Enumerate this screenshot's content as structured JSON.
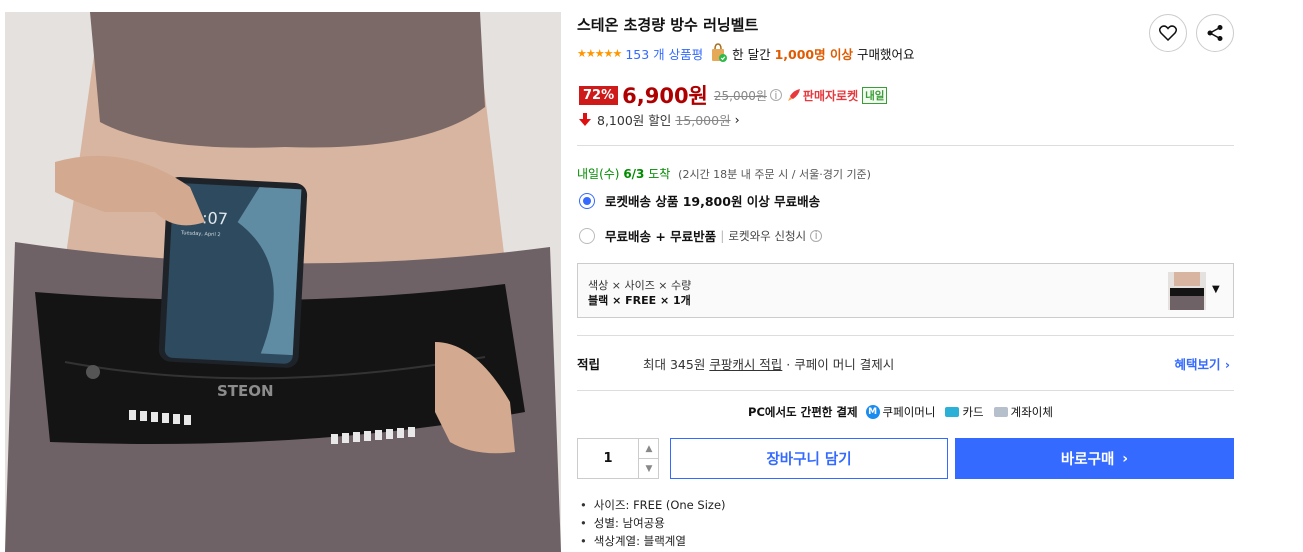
{
  "product": {
    "title": "스테온 초경량 방수 러닝벨트",
    "image_alt": "STEON",
    "rating_stars": "★★★★★",
    "review_count": "153 개 상품평",
    "buyers_prefix": "한 달간",
    "buyers_count": "1,000명 이상",
    "buyers_suffix": "구매했어요"
  },
  "price": {
    "discount": "72%",
    "sale": "6,900원",
    "original": "25,000원",
    "info_icon": "i",
    "rocket_label": "판매자로켓",
    "badge": "내일",
    "coupon_amount": "8,100원",
    "coupon_label": "할인",
    "coupon_original": "15,000원",
    "coupon_arrow": "›"
  },
  "delivery": {
    "day": "내일(수)",
    "date": "6/3",
    "arrive": "도착",
    "detail": "(2시간 18분 내 주문 시 / 서울·경기 기준)"
  },
  "shipping_options": [
    {
      "label": "로켓배송 상품 19,800원 이상 무료배송",
      "sub": "",
      "checked": true
    },
    {
      "label": "무료배송 + 무료반품",
      "sub": "로켓와우 신청시",
      "checked": false
    }
  ],
  "option": {
    "header": "색상 × 사이즈 × 수량",
    "value": "블랙 × FREE × 1개",
    "caret": "▼"
  },
  "points": {
    "label": "적립",
    "text_prefix": "최대 345원",
    "text_link": "쿠팡캐시 적립",
    "text_suffix": "· 쿠페이 머니 결제시",
    "benefit_link": "혜택보기 ›"
  },
  "payment": {
    "title": "PC에서도 간편한 결제",
    "methods": [
      {
        "name": "쿠페이머니",
        "icon": "m-icon"
      },
      {
        "name": "카드",
        "icon": "card-icon"
      },
      {
        "name": "계좌이체",
        "icon": "bank-icon"
      }
    ],
    "m_glyph": "M"
  },
  "purchase": {
    "quantity": "1",
    "up": "▲",
    "down": "▼",
    "cart_label": "장바구니 담기",
    "buy_label": "바로구매",
    "buy_arrow": "›"
  },
  "specs": [
    "사이즈: FREE (One Size)",
    "성별: 남여공용",
    "색상계열: 블랙계열"
  ],
  "colors": {
    "accent_blue": "#346aff",
    "sale_red": "#ae0000",
    "badge_red": "#cf1a1a",
    "delivery_green": "#008c00",
    "star_orange": "#ff9600"
  }
}
